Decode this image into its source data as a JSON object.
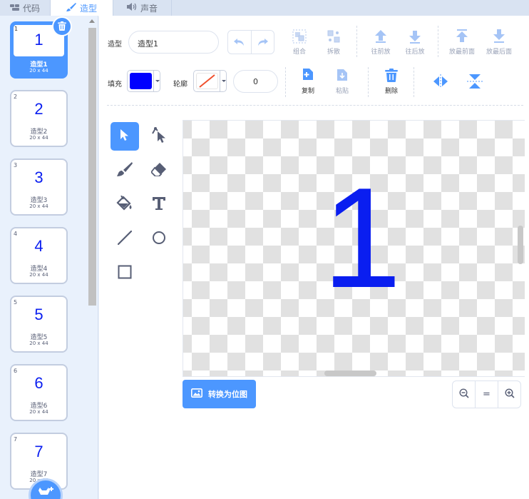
{
  "tabs": [
    {
      "label": "代码",
      "icon": "code-blocks-icon"
    },
    {
      "label": "造型",
      "icon": "paintbrush-icon"
    },
    {
      "label": "声音",
      "icon": "speaker-icon"
    }
  ],
  "costumes": [
    {
      "num": "1",
      "glyph": "1",
      "name": "造型1",
      "size": "20 x 44"
    },
    {
      "num": "2",
      "glyph": "2",
      "name": "造型2",
      "size": "20 x 44"
    },
    {
      "num": "3",
      "glyph": "3",
      "name": "造型3",
      "size": "20 x 44"
    },
    {
      "num": "4",
      "glyph": "4",
      "name": "造型4",
      "size": "20 x 44"
    },
    {
      "num": "5",
      "glyph": "5",
      "name": "造型5",
      "size": "20 x 44"
    },
    {
      "num": "6",
      "glyph": "6",
      "name": "造型6",
      "size": "20 x 44"
    },
    {
      "num": "7",
      "glyph": "7",
      "name": "造型7",
      "size": "20 x 44"
    }
  ],
  "toolbar": {
    "costume_label": "造型",
    "costume_name": "造型1",
    "group": "组合",
    "ungroup": "拆散",
    "forward": "往前放",
    "backward": "往后放",
    "front": "放最前面",
    "back": "放最后面",
    "fill_label": "填充",
    "fill_color": "#0000ff",
    "outline_label": "轮廓",
    "outline_width": "0",
    "copy": "复制",
    "paste": "粘贴",
    "delete": "删除"
  },
  "canvas": {
    "glyph": "1",
    "glyph_color": "#0a1ef0"
  },
  "convert_label": "转换为位图",
  "zoom": {
    "out": "−",
    "reset": "=",
    "in": "+"
  },
  "colors": {
    "accent": "#4c97ff",
    "costume_text": "#0a1ef0"
  }
}
